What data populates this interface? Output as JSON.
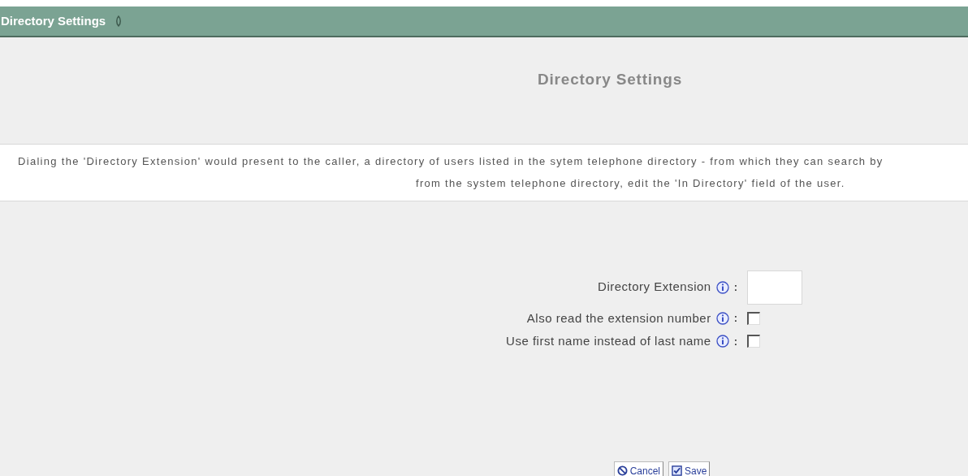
{
  "header": {
    "title": "Directory Settings"
  },
  "title": "Directory Settings",
  "description": {
    "lines": [
      "Dialing the 'Directory Extension' would present to the caller, a directory of users listed in the sytem telephone directory - from which they can search by",
      "from the system telephone directory, edit the 'In Directory' field of the user."
    ]
  },
  "fields": [
    {
      "kind": "text",
      "label": "Directory Extension",
      "colon": ":"
    },
    {
      "kind": "checkbox",
      "label": "Also read the extension number",
      "colon": ":",
      "checked": false
    },
    {
      "kind": "checkbox",
      "label": "Use first name instead of last name",
      "colon": ":",
      "checked": false
    }
  ],
  "buttons": [
    {
      "kind": "cancel",
      "label": "Cancel"
    },
    {
      "kind": "save",
      "label": "Save"
    }
  ]
}
